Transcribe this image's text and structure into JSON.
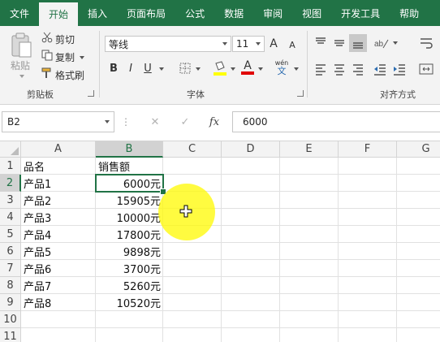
{
  "menu": {
    "tabs": [
      "文件",
      "开始",
      "插入",
      "页面布局",
      "公式",
      "数据",
      "审阅",
      "视图",
      "开发工具",
      "帮助"
    ],
    "active_tab": "开始"
  },
  "ribbon": {
    "clipboard": {
      "paste": "粘贴",
      "cut": "剪切",
      "copy": "复制",
      "format_painter": "格式刷",
      "group_label": "剪贴板"
    },
    "font": {
      "font_name": "等线",
      "font_size": "11",
      "bold": "B",
      "italic": "I",
      "underline": "U",
      "grow": "A",
      "shrink": "A",
      "font_color_letter": "A",
      "phonetic": "wén",
      "group_label": "字体"
    },
    "alignment": {
      "group_label": "对齐方式"
    }
  },
  "formula_bar": {
    "name_box": "B2",
    "cancel": "✕",
    "enter": "✓",
    "fx": "fx",
    "content": "6000"
  },
  "sheet": {
    "columns": [
      "A",
      "B",
      "C",
      "D",
      "E",
      "F",
      "G"
    ],
    "rows": [
      "1",
      "2",
      "3",
      "4",
      "5",
      "6",
      "7",
      "8",
      "9",
      "10",
      "11"
    ],
    "selected_cell": "B2",
    "header": {
      "A": "品名",
      "B": "销售额"
    },
    "data": [
      {
        "name": "产品1",
        "sales": "6000元"
      },
      {
        "name": "产品2",
        "sales": "15905元"
      },
      {
        "name": "产品3",
        "sales": "10000元"
      },
      {
        "name": "产品4",
        "sales": "17800元"
      },
      {
        "name": "产品5",
        "sales": "9898元"
      },
      {
        "name": "产品6",
        "sales": "3700元"
      },
      {
        "name": "产品7",
        "sales": "5260元"
      },
      {
        "name": "产品8",
        "sales": "10520元"
      }
    ]
  },
  "colors": {
    "excel_green": "#217346",
    "cursor_highlight": "#fff700"
  }
}
